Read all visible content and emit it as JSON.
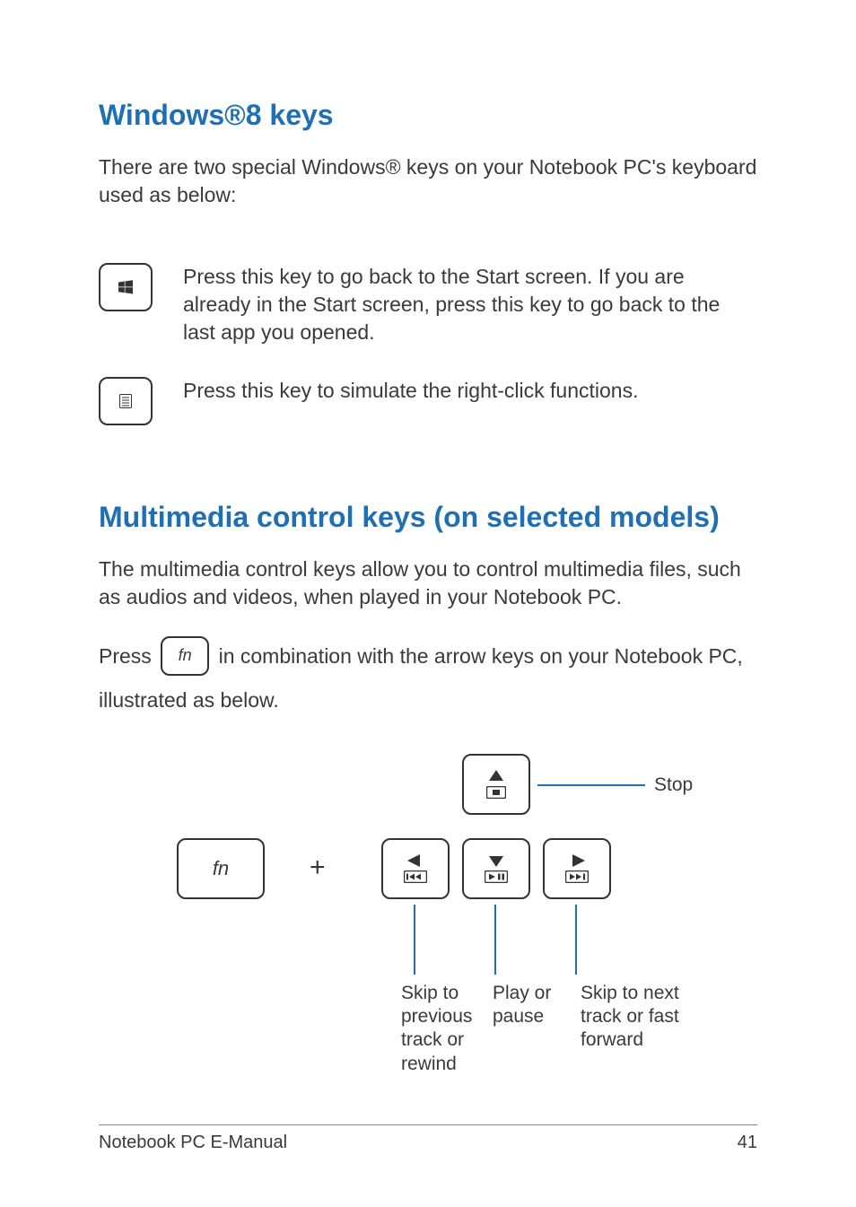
{
  "section1": {
    "title": "Windows®8 keys",
    "intro": "There are two special Windows® keys on your Notebook PC's keyboard used as below:",
    "rows": [
      {
        "desc": "Press this key to go back to the Start screen. If you are already in the Start screen, press this key to go back to the last app you opened."
      },
      {
        "desc": "Press this key to simulate the right-click functions."
      }
    ]
  },
  "section2": {
    "title": "Multimedia control keys (on selected models)",
    "intro": "The multimedia control keys allow you to control multimedia files, such as audios and videos, when played in your Notebook PC.",
    "press_prefix": "Press ",
    "press_suffix": " in combination with the arrow keys on your Notebook PC, illustrated as below.",
    "fn_label": "fn",
    "plus": "+",
    "callouts": {
      "stop": "Stop",
      "prev": "Skip to previous track or rewind",
      "play": "Play or pause",
      "next": "Skip to next track or fast forward"
    }
  },
  "footer": {
    "left": "Notebook PC E-Manual",
    "right": "41"
  }
}
